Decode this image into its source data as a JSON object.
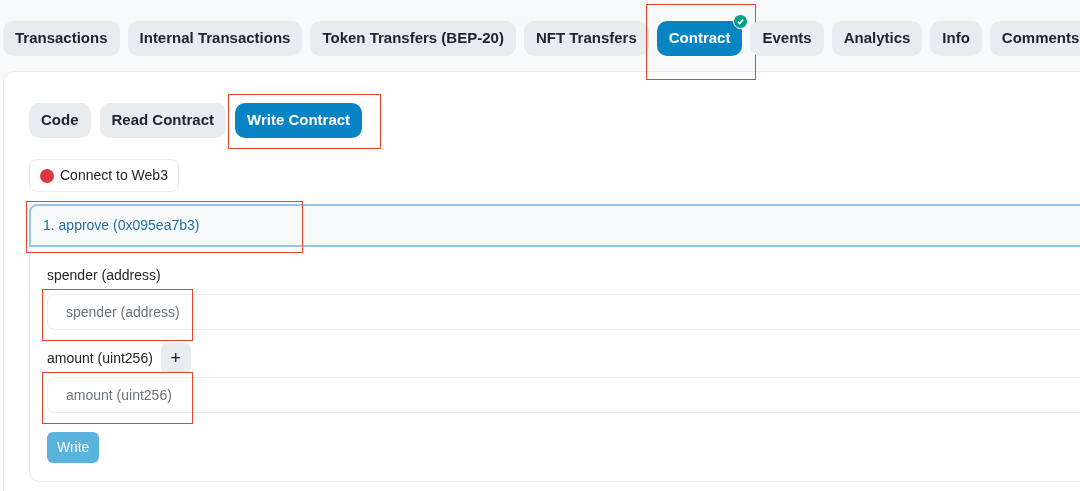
{
  "tabs": [
    {
      "label": "Transactions",
      "selected": false,
      "highlighted": false
    },
    {
      "label": "Internal Transactions",
      "selected": false,
      "highlighted": false
    },
    {
      "label": "Token Transfers (BEP-20)",
      "selected": false,
      "highlighted": false
    },
    {
      "label": "NFT Transfers",
      "selected": false,
      "highlighted": false
    },
    {
      "label": "Contract",
      "selected": true,
      "highlighted": true,
      "verified": true
    },
    {
      "label": "Events",
      "selected": false,
      "highlighted": false
    },
    {
      "label": "Analytics",
      "selected": false,
      "highlighted": false
    },
    {
      "label": "Info",
      "selected": false,
      "highlighted": false
    },
    {
      "label": "Comments",
      "selected": false,
      "highlighted": false
    }
  ],
  "subtabs": [
    {
      "label": "Code",
      "selected": false,
      "highlighted": false
    },
    {
      "label": "Read Contract",
      "selected": false,
      "highlighted": false
    },
    {
      "label": "Write Contract",
      "selected": true,
      "highlighted": true
    }
  ],
  "connect_button": {
    "label": "Connect to Web3",
    "connected": false
  },
  "function": {
    "title": "1. approve (0x095ea7b3)",
    "highlighted": true,
    "expanded": true,
    "inputs": [
      {
        "label": "spender (address)",
        "placeholder": "spender (address)",
        "highlighted": true,
        "expandable": false
      },
      {
        "label": "amount (uint256)",
        "placeholder": "amount (uint256)",
        "highlighted": true,
        "expandable": true,
        "expand_label": "+"
      }
    ],
    "write_button": "Write"
  }
}
